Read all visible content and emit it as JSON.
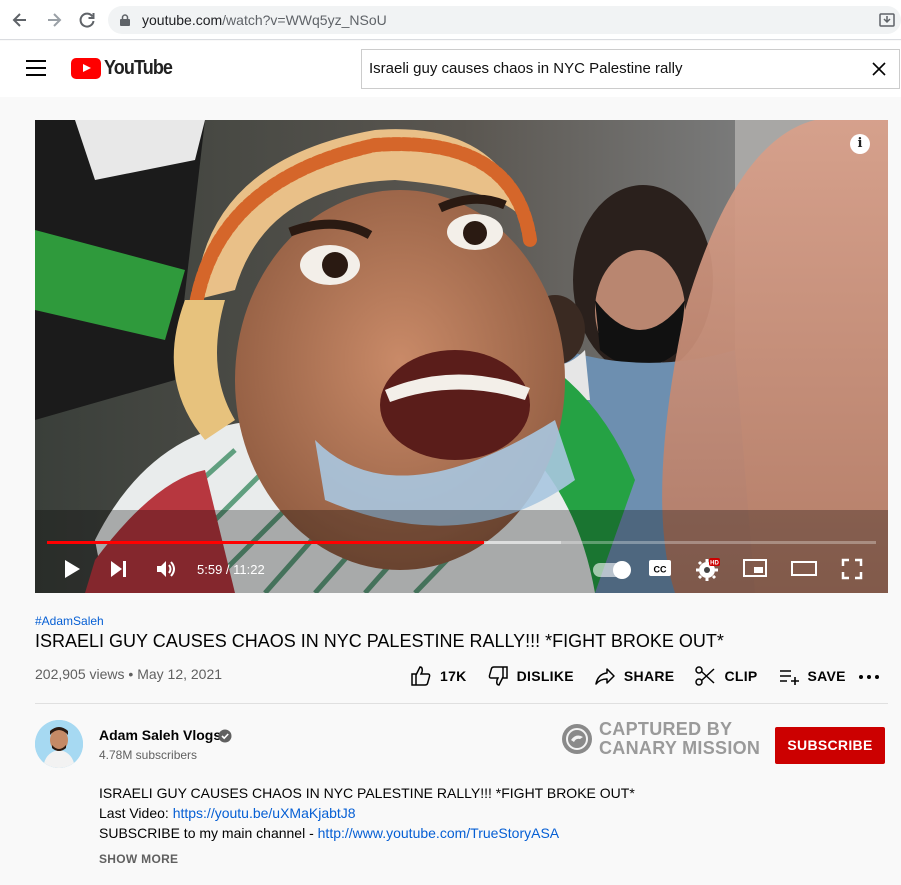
{
  "browser": {
    "url_host": "youtube.com",
    "url_path": "/watch?v=WWq5yz_NSoU"
  },
  "header": {
    "logo_text": "YouTube",
    "search_value": "Israeli guy causes chaos in NYC Palestine rally"
  },
  "player": {
    "current_time": "5:59 / 11:22",
    "progress_fraction": 0.527,
    "buffered_fraction": 0.62,
    "info_icon": "i"
  },
  "video": {
    "hashtag": "#AdamSaleh",
    "title": "ISRAELI GUY CAUSES CHAOS IN NYC PALESTINE RALLY!!! *FIGHT BROKE OUT*",
    "views": "202,905 views",
    "separator": "•",
    "date": "May 12, 2021"
  },
  "actions": {
    "like": "17K",
    "dislike": "DISLIKE",
    "share": "SHARE",
    "clip": "CLIP",
    "save": "SAVE"
  },
  "channel": {
    "name": "Adam Saleh Vlogs",
    "subscribers": "4.78M subscribers",
    "subscribe_label": "SUBSCRIBE"
  },
  "watermark": {
    "line1": "CAPTURED BY",
    "line2": "CANARY MISSION"
  },
  "description": {
    "line1": "ISRAELI GUY CAUSES CHAOS IN NYC PALESTINE RALLY!!! *FIGHT BROKE OUT*",
    "line2_prefix": "Last Video: ",
    "line2_link": "https://youtu.be/uXMaKjabtJ8",
    "line3_prefix": "SUBSCRIBE to my main channel - ",
    "line3_link": "http://www.youtube.com/TrueStoryASA",
    "show_more": "SHOW MORE"
  },
  "colors": {
    "brand_red": "#ff0000",
    "subscribe_red": "#cc0000",
    "link_blue": "#065fd4"
  }
}
